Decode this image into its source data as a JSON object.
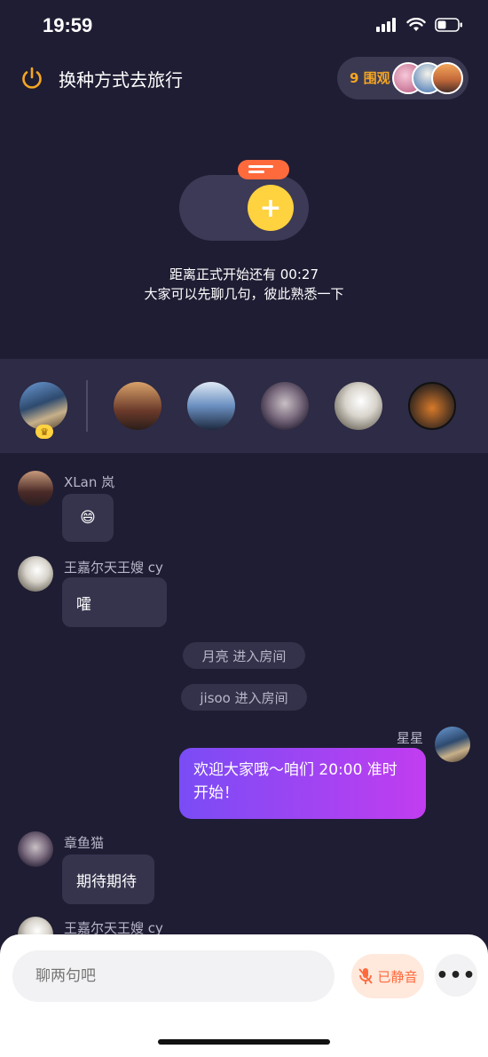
{
  "status": {
    "time": "19:59"
  },
  "header": {
    "title": "换种方式去旅行",
    "viewers_label": "9 围观"
  },
  "stage": {
    "countdown_line1": "距离正式开始还有 00:27",
    "countdown_line2": "大家可以先聊几句，彼此熟悉一下",
    "add_symbol": "+"
  },
  "chat": {
    "messages": [
      {
        "name": "XLan 岚",
        "text": "😄"
      },
      {
        "name": "王嘉尔天王嫂 cy",
        "text": "嚯"
      },
      {
        "system": "月亮 进入房间"
      },
      {
        "system": "jisoo 进入房间"
      },
      {
        "name": "星星",
        "text": "欢迎大家哦～咱们 20:00 准时开始！",
        "self": true
      },
      {
        "name": "章鱼猫",
        "text": "期待期待"
      },
      {
        "name": "王嘉尔天王嫂 cy"
      }
    ]
  },
  "bottom": {
    "input_placeholder": "聊两句吧",
    "mute_label": "已静音",
    "more_label": "•••"
  },
  "colors": {
    "background": "#1f1d33",
    "accent_yellow": "#ffd23f",
    "accent_orange": "#ff6a3d",
    "self_bubble_start": "#7a4cf5",
    "self_bubble_end": "#c13df0"
  }
}
